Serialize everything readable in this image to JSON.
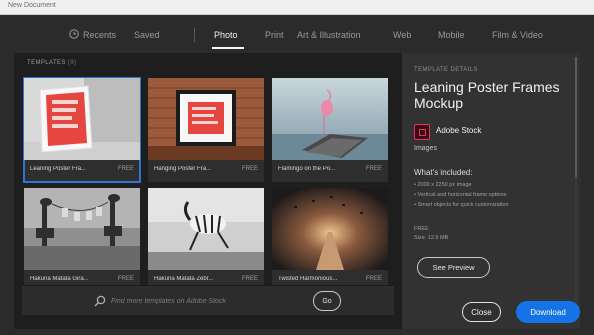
{
  "window": {
    "title": "New Document"
  },
  "tabs": [
    {
      "label": "Recents"
    },
    {
      "label": "Saved"
    },
    {
      "label": "Photo"
    },
    {
      "label": "Print"
    },
    {
      "label": "Art & Illustration"
    },
    {
      "label": "Web"
    },
    {
      "label": "Mobile"
    },
    {
      "label": "Film & Video"
    }
  ],
  "active_tab": "Photo",
  "templates": {
    "label": "TEMPLATES",
    "count": "(9)",
    "items": [
      {
        "caption": "Leaning Poster Fra...",
        "badge": "FREE",
        "selected": true
      },
      {
        "caption": "Hanging Poster Fra...",
        "badge": "FREE"
      },
      {
        "caption": "Flamingo on the Po...",
        "badge": "FREE"
      },
      {
        "caption": "Hakuna Matata Gira...",
        "badge": "FREE"
      },
      {
        "caption": "Hakuna Matata Zebr...",
        "badge": "FREE"
      },
      {
        "caption": "Twisted Harmonious...",
        "badge": "FREE"
      }
    ]
  },
  "search": {
    "placeholder": "Find more templates on Adobe Stock",
    "go_label": "Go"
  },
  "details": {
    "section_label": "TEMPLATE DETAILS",
    "title": "Leaning Poster Frames Mockup",
    "provider": "Adobe Stock",
    "provider_sub": "Images",
    "whats_included_title": "What's included:",
    "included": [
      "• 2000 x 2250 px image",
      "• Vertical and horizontal frame options",
      "• Smart objects for quick customization"
    ],
    "price": "FREE",
    "size": "Size: 12.9 MB",
    "preview_label": "See Preview"
  },
  "footer": {
    "close_label": "Close",
    "download_label": "Download"
  },
  "colors": {
    "accent": "#1473e6",
    "selection": "#2d74d6",
    "stock_brand": "#e0365d"
  }
}
